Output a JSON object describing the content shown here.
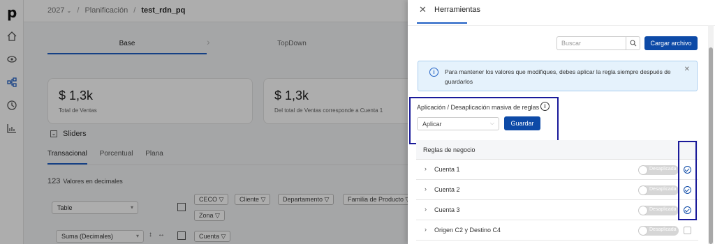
{
  "app": {
    "logo": "p",
    "breadcrumb": {
      "year": "2027",
      "section": "Planificación",
      "file": "test_rdn_pq"
    },
    "steps": [
      "Base",
      "TopDown"
    ],
    "cards": [
      {
        "value": "$ 1,3k",
        "label": "Total de Ventas"
      },
      {
        "value": "$ 1,3k",
        "label": "Del total de Ventas corresponde a Cuenta 1"
      }
    ],
    "sliders_label": "Sliders",
    "subtabs": [
      "Transacional",
      "Porcentual",
      "Plana"
    ],
    "decimals": {
      "number": "123",
      "label": "Valores en decimales"
    },
    "view_select": "Table",
    "agg_select": "Suma (Decimales)",
    "filter_chips": [
      "CECO",
      "Cliente",
      "Departamento",
      "Familia de Producto",
      "Zona",
      "Cuenta"
    ]
  },
  "panel": {
    "title": "Herramientas",
    "search_placeholder": "Buscar",
    "upload_label": "Cargar archivo",
    "info_text": "Para mantener los valores que modifiques, debes aplicar la regla siempre después de guardarlos",
    "mass_label": "Aplicación / Desaplicación masiva de reglas",
    "mass_select": "Aplicar",
    "save_label": "Guardar",
    "rules_header": "Reglas de negocio",
    "rules": [
      {
        "name": "Cuenta 1",
        "status": "Desaplicada",
        "checked": true
      },
      {
        "name": "Cuenta 2",
        "status": "Desaplicada",
        "checked": true
      },
      {
        "name": "Cuenta 3",
        "status": "Desaplicada",
        "checked": true
      },
      {
        "name": "Origen C2 y Destino C4",
        "status": "Desaplicada",
        "checked": false
      }
    ]
  },
  "colors": {
    "primary": "#0d4aa7",
    "highlight_border": "#1a1a9a",
    "info_bg": "#e5f2fc"
  }
}
